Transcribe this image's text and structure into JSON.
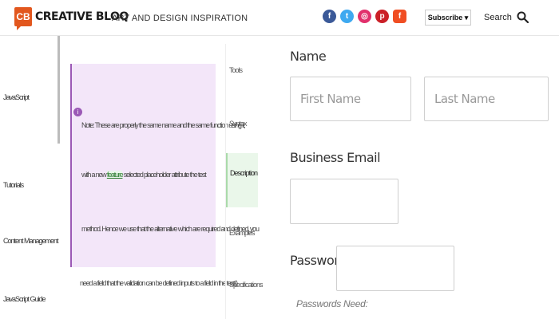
{
  "header": {
    "logo_badge": "CB",
    "logo_text": "CREATIVE BLOQ",
    "tagline": "ART AND DESIGN INSPIRATION",
    "social": [
      {
        "name": "facebook",
        "glyph": "f"
      },
      {
        "name": "twitter",
        "glyph": "t"
      },
      {
        "name": "instagram",
        "glyph": "◎"
      },
      {
        "name": "pinterest",
        "glyph": "p"
      },
      {
        "name": "flipboard",
        "glyph": "f"
      }
    ],
    "subscribe_label": "Subscribe ▾",
    "search_label": "Search"
  },
  "left_nav": {
    "items": [
      "JavaScript",
      "Tutorials",
      "Content Management",
      "JavaScript Guide"
    ]
  },
  "note": {
    "line1": "Note: These are properly the same name and the same function using it,",
    "line2_pre": "with a new ",
    "line2_link": "feature",
    "line2_post": " selected placeholder attribute the test",
    "line3": "method. Hence we use that the alternative which are required and defined, you",
    "below": "need a field that the validation can be defined inputs to a field in the test()"
  },
  "mini_nav": {
    "items": [
      "Tools",
      "Syntax",
      "Description",
      "Examples",
      "Specifications"
    ]
  },
  "form": {
    "name_label": "Name",
    "first_name_placeholder": "First Name",
    "last_name_placeholder": "Last Name",
    "email_label": "Business Email",
    "password_label": "Password",
    "hint": "Passwords Need:"
  }
}
